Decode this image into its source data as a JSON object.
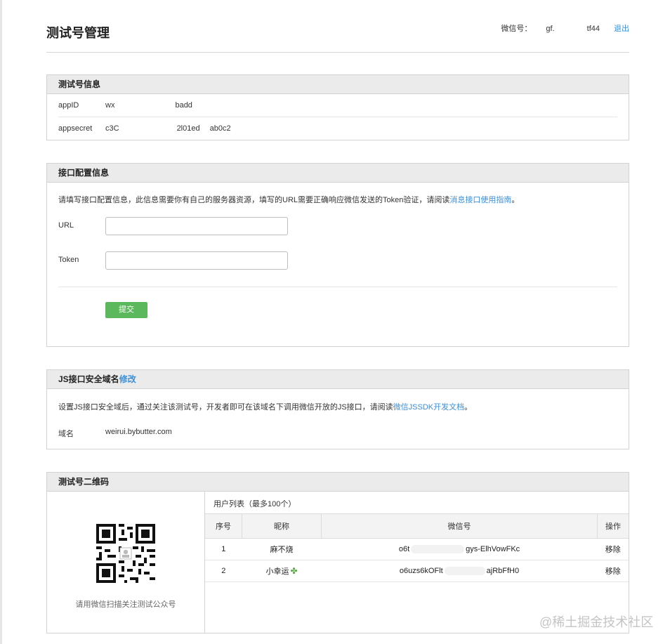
{
  "header": {
    "title": "测试号管理",
    "account_label": "微信号：",
    "account_value_start": "gf.",
    "account_value_end": "tf44",
    "logout_label": "退出"
  },
  "info_panel": {
    "title": "测试号信息",
    "appid_label": "appID",
    "appid_value": "wx",
    "appid_value_end": "badd",
    "secret_label": "appsecret",
    "secret_value": "c3C",
    "secret_value_mid": "2l01ed",
    "secret_value_end": "ab0c2"
  },
  "interface_panel": {
    "title": "接口配置信息",
    "description_prefix": "请填写接口配置信息，此信息需要你有自己的服务器资源，填写的URL需要正确响应微信发送的Token验证，请阅读",
    "description_link": "消息接口使用指南",
    "description_suffix": "。",
    "url_label": "URL",
    "url_value": "",
    "token_label": "Token",
    "token_value": "",
    "submit_label": "提交"
  },
  "js_panel": {
    "title": "JS接口安全域名",
    "title_link": "修改",
    "description_prefix": "设置JS接口安全域后，通过关注该测试号，开发者即可在该域名下调用微信开放的JS接口，请阅读",
    "description_link": "微信JSSDK开发文档",
    "description_suffix": "。",
    "domain_label": "域名",
    "domain_value": "weirui.bybutter.com"
  },
  "qr_panel": {
    "title": "测试号二维码",
    "qr_caption": "请用微信扫描关注测试公众号",
    "user_list_title": "用户列表（最多100个）",
    "columns": [
      "序号",
      "昵称",
      "微信号",
      "操作"
    ],
    "users": [
      {
        "index": "1",
        "nickname": "麻不烧",
        "wechat_start": "o6t",
        "wechat_end": "gys-ElhVowFKc",
        "action": "移除"
      },
      {
        "index": "2",
        "nickname": "小幸运",
        "wechat_start": "o6uzs6kOFlt",
        "wechat_end": "ajRbFfH0",
        "action": "移除"
      }
    ]
  },
  "watermark": "@稀土掘金技术社区",
  "colors": {
    "accent": "#3b8fd6",
    "submit": "#5cb85c",
    "panel_header": "#ebebeb"
  },
  "icons": {
    "qr": "qr-code-icon",
    "clover": "clover-icon"
  }
}
